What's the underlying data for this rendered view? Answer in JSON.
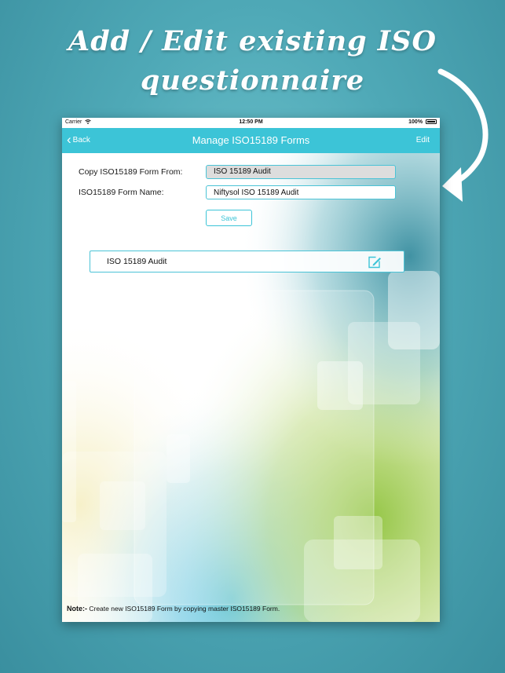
{
  "promo": {
    "title_line1": "Add / Edit existing ISO",
    "title_line2": "questionnaire"
  },
  "status_bar": {
    "carrier": "Carrier",
    "time": "12:50 PM",
    "battery": "100%"
  },
  "nav": {
    "back_label": "Back",
    "title": "Manage ISO15189 Forms",
    "edit_label": "Edit"
  },
  "form": {
    "copy_from_label": "Copy ISO15189 Form From:",
    "copy_from_value": "ISO 15189 Audit",
    "name_label": "ISO15189 Form Name:",
    "name_value": "Niftysol ISO 15189 Audit",
    "save_label": "Save"
  },
  "forms_list": [
    {
      "label": "ISO 15189 Audit"
    }
  ],
  "note": {
    "prefix": "Note:-",
    "text": " Create new ISO15189 Form by copying master ISO15189 Form."
  },
  "icons": {
    "back": "chevron-left-icon",
    "wifi": "wifi-icon",
    "battery": "battery-icon",
    "edit": "edit-pencil-icon",
    "arrow": "curved-arrow-icon"
  },
  "colors": {
    "accent": "#3cc4d7",
    "background": "#4fa9b7",
    "field_disabled": "#dddddd"
  }
}
